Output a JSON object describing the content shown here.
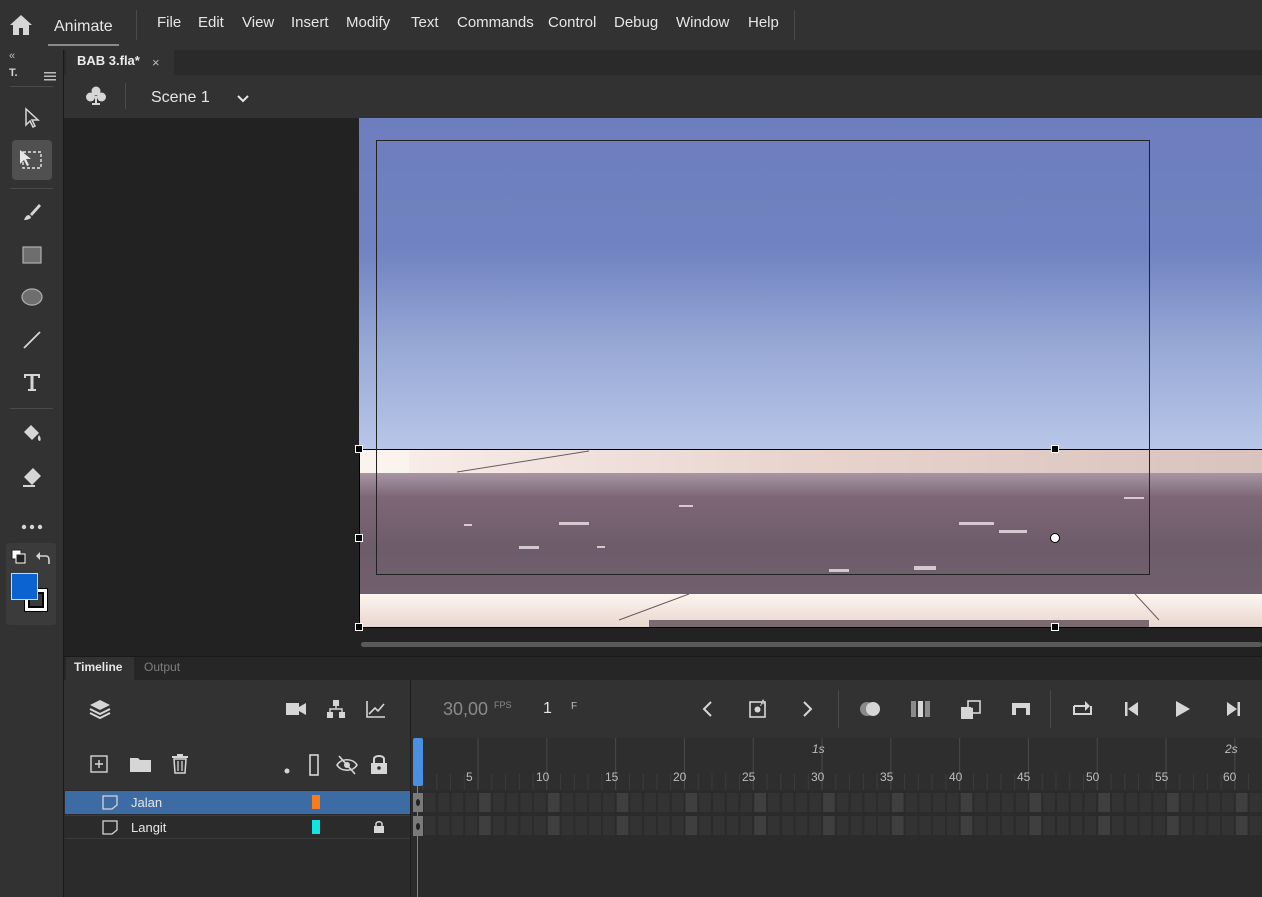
{
  "app": {
    "name": "Animate"
  },
  "menu": [
    "File",
    "Edit",
    "View",
    "Insert",
    "Modify",
    "Text",
    "Commands",
    "Control",
    "Debug",
    "Window",
    "Help"
  ],
  "toolbar": {
    "panel_label": "T.",
    "collapse": "«"
  },
  "document": {
    "tab_label": "BAB 3.fla*",
    "close_glyph": "×"
  },
  "scene": {
    "label": "Scene 1"
  },
  "timeline": {
    "tabs": {
      "timeline": "Timeline",
      "output": "Output"
    },
    "fps_value": "30,00",
    "fps_unit": "FPS",
    "current_frame": "1",
    "frame_unit": "F",
    "layers": [
      {
        "name": "Jalan",
        "color": "#f57c1f",
        "selected": true,
        "locked": false
      },
      {
        "name": "Langit",
        "color": "#12e3e3",
        "selected": false,
        "locked": true
      }
    ],
    "ruler_ticks": [
      "5",
      "10",
      "15",
      "20",
      "25",
      "30",
      "35",
      "40",
      "45",
      "50",
      "55",
      "60"
    ],
    "second_markers": [
      "1s",
      "2s"
    ]
  },
  "colors": {
    "fill": "#0a63d0",
    "stroke": "#000000",
    "accent": "#4a8fe0"
  }
}
